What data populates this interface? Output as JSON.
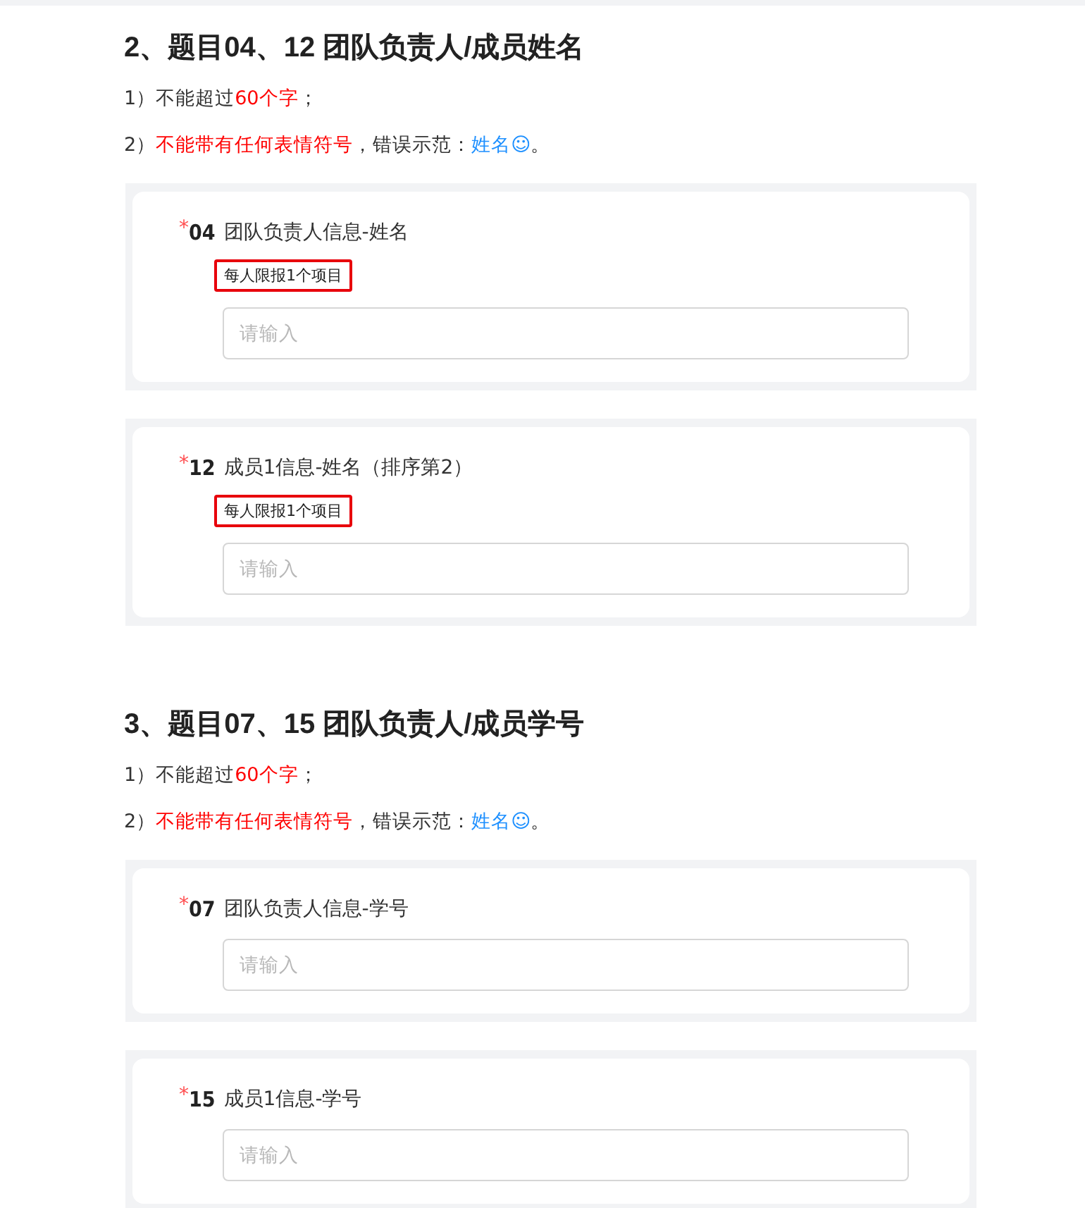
{
  "sections": [
    {
      "heading": "2、题目04、12 团队负责人/成员姓名",
      "rules": [
        [
          {
            "text": "1）不能超过",
            "kind": "plain"
          },
          {
            "text": "60个字",
            "kind": "warning"
          },
          {
            "text": "；",
            "kind": "plain"
          }
        ],
        [
          {
            "text": "2）",
            "kind": "plain"
          },
          {
            "text": "不能带有任何表情符号",
            "kind": "warning"
          },
          {
            "text": "，错误示范：",
            "kind": "plain"
          },
          {
            "text": "姓名☺",
            "kind": "example"
          },
          {
            "text": "。",
            "kind": "plain"
          }
        ]
      ],
      "questions": [
        {
          "mark": "*",
          "number": "04",
          "label": "团队负责人信息-姓名",
          "tag": "每人限报1个项目",
          "placeholder": "请输入"
        },
        {
          "mark": "*",
          "number": "12",
          "label": "成员1信息-姓名（排序第2）",
          "tag": "每人限报1个项目",
          "placeholder": "请输入"
        }
      ]
    },
    {
      "heading": "3、题目07、15 团队负责人/成员学号",
      "rules": [
        [
          {
            "text": "1）不能超过",
            "kind": "plain"
          },
          {
            "text": "60个字",
            "kind": "warning"
          },
          {
            "text": "；",
            "kind": "plain"
          }
        ],
        [
          {
            "text": "2）",
            "kind": "plain"
          },
          {
            "text": "不能带有任何表情符号",
            "kind": "warning"
          },
          {
            "text": "，错误示范：",
            "kind": "plain"
          },
          {
            "text": "姓名☺",
            "kind": "example"
          },
          {
            "text": "。",
            "kind": "plain"
          }
        ]
      ],
      "questions": [
        {
          "mark": "*",
          "number": "07",
          "label": "团队负责人信息-学号",
          "placeholder": "请输入"
        },
        {
          "mark": "*",
          "number": "15",
          "label": "成员1信息-学号",
          "placeholder": "请输入"
        }
      ]
    }
  ]
}
